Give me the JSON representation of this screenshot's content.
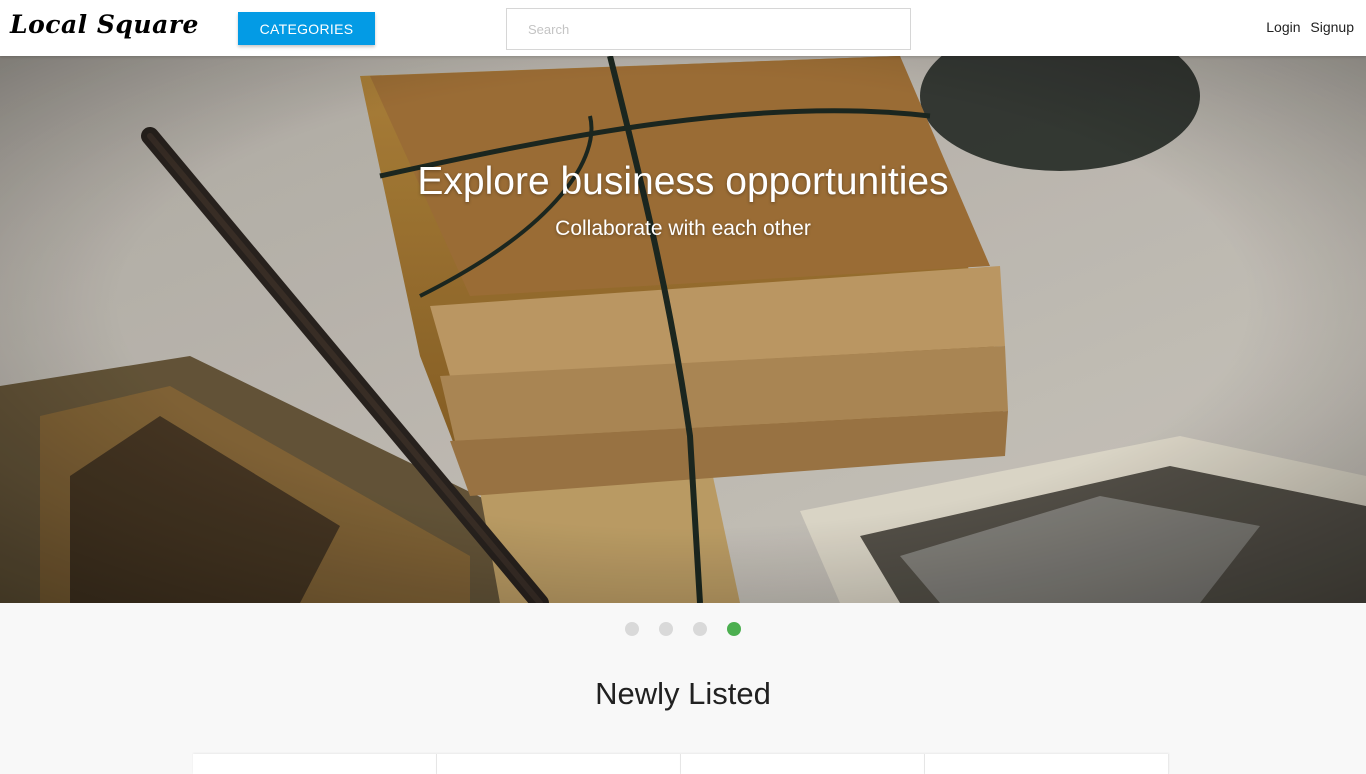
{
  "navbar": {
    "logo": "Local Square",
    "categories_label": "CATEGORIES",
    "search_placeholder": "Search",
    "login_label": "Login",
    "signup_label": "Signup"
  },
  "hero": {
    "title": "Explore business opportunities",
    "subtitle": "Collaborate with each other"
  },
  "carousel": {
    "slide_count": 4,
    "active_index": 3,
    "active_color": "#4caf50",
    "inactive_color": "#d9d9d9"
  },
  "section": {
    "title": "Newly Listed"
  },
  "colors": {
    "primary": "#039be5",
    "page_bg": "#f8f8f8"
  }
}
